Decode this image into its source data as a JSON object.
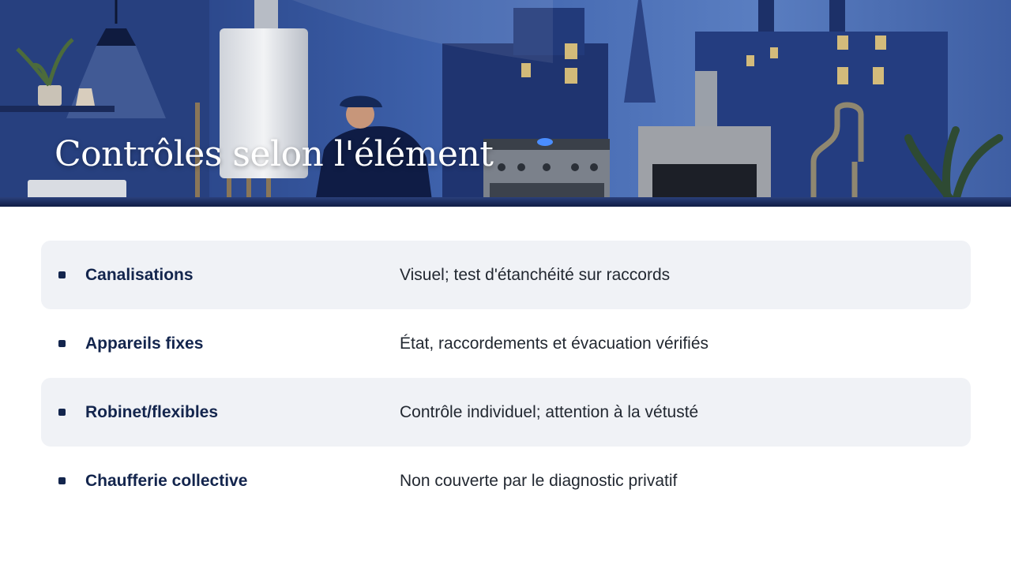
{
  "header": {
    "title": "Contrôles selon l'élément"
  },
  "rows": [
    {
      "label": "Canalisations",
      "description": "Visuel; test d'étanchéité sur raccords",
      "shaded": true
    },
    {
      "label": "Appareils fixes",
      "description": "État, raccordements et évacuation vérifiés",
      "shaded": false
    },
    {
      "label": "Robinet/flexibles",
      "description": "Contrôle individuel; attention à la vétusté",
      "shaded": true
    },
    {
      "label": "Chaufferie collective",
      "description": "Non couverte par le diagnostic privatif",
      "shaded": false
    }
  ],
  "colors": {
    "banner_dark": "#1b2f66",
    "banner_light": "#5b7ec2",
    "row_shade": "#f0f2f6",
    "accent": "#13254d"
  }
}
